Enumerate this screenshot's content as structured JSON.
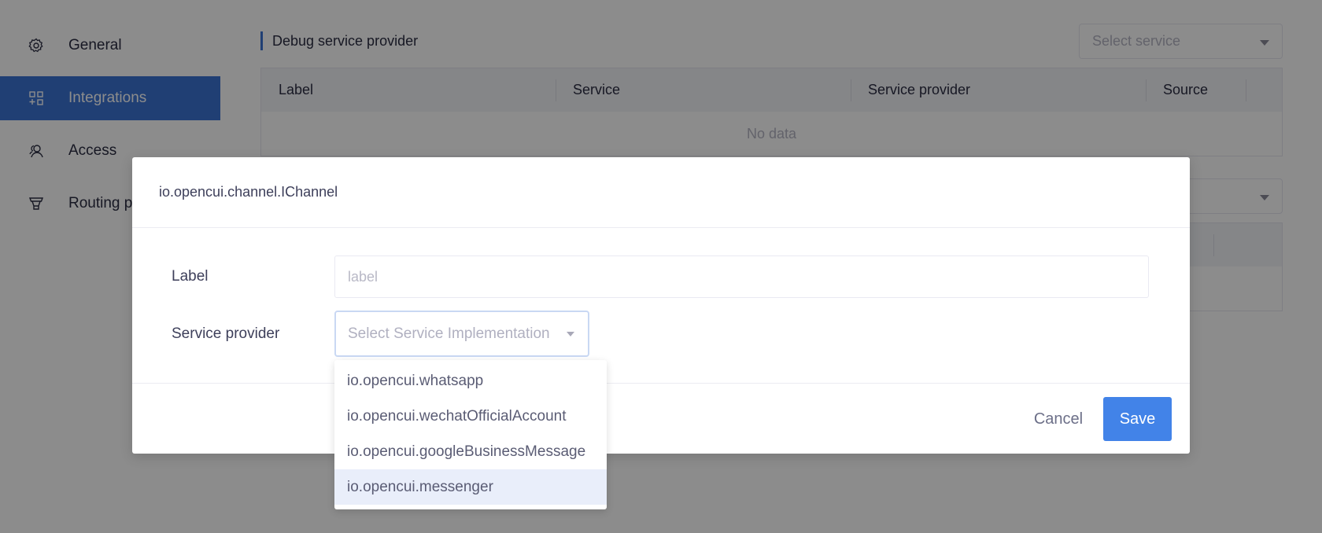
{
  "sidebar": {
    "items": [
      {
        "label": "General",
        "icon": "gear-icon",
        "active": false
      },
      {
        "label": "Integrations",
        "icon": "integrations-icon",
        "active": true
      },
      {
        "label": "Access",
        "icon": "users-icon",
        "active": false
      },
      {
        "label": "Routing p",
        "icon": "funnel-icon",
        "active": false
      }
    ]
  },
  "main": {
    "section_title": "Debug service provider",
    "service_select_placeholder": "Select service",
    "table": {
      "columns": [
        "Label",
        "Service",
        "Service provider",
        "Source"
      ],
      "empty_text": "No data"
    }
  },
  "modal": {
    "title": "io.opencui.channel.IChannel",
    "fields": {
      "label": {
        "label": "Label",
        "placeholder": "label",
        "value": ""
      },
      "service_provider": {
        "label": "Service provider",
        "placeholder": "Select Service Implementation",
        "value": ""
      }
    },
    "dropdown_options": [
      "io.opencui.whatsapp",
      "io.opencui.wechatOfficialAccount",
      "io.opencui.googleBusinessMessage",
      "io.opencui.messenger"
    ],
    "hovered_option": "io.opencui.messenger",
    "buttons": {
      "cancel": "Cancel",
      "save": "Save"
    }
  },
  "colors": {
    "accent": "#4283e8",
    "sidebar_active": "#3b73d4",
    "option_hover": "#e9eefa"
  }
}
